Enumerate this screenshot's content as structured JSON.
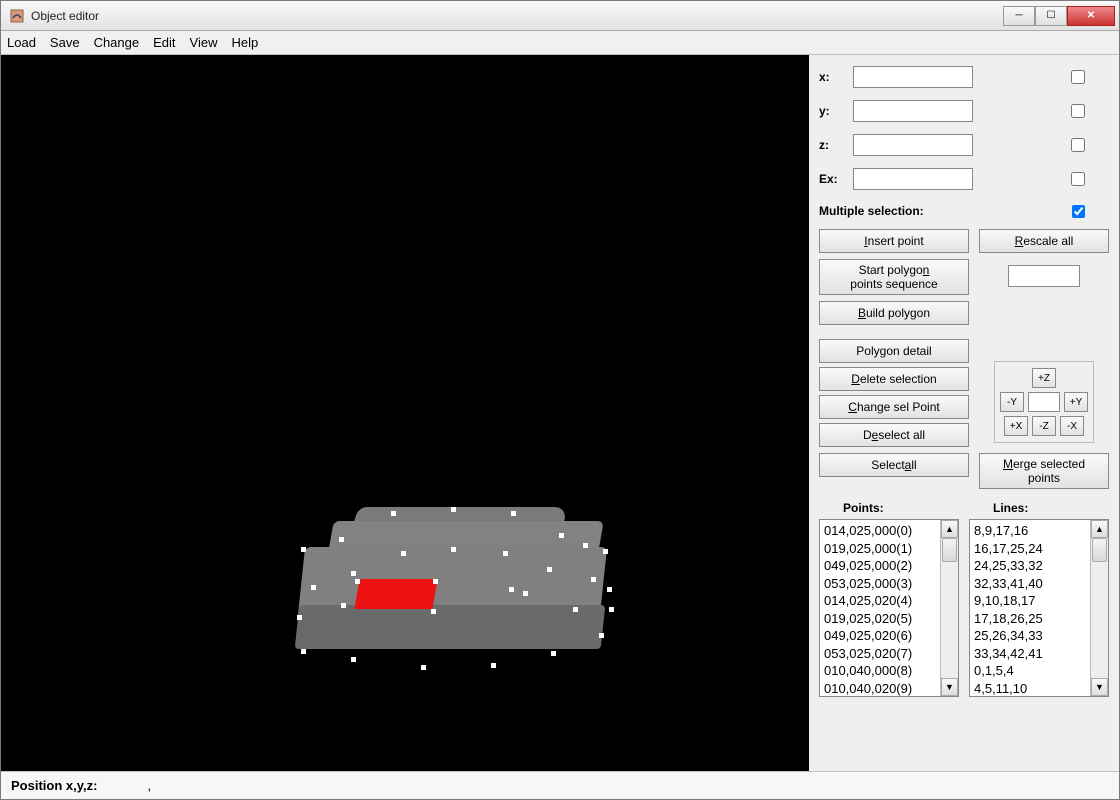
{
  "window": {
    "title": "Object editor"
  },
  "menu": {
    "load": "Load",
    "save": "Save",
    "change": "Change",
    "edit": "Edit",
    "view": "View",
    "help": "Help"
  },
  "coords": {
    "x_label": "x:",
    "x_value": "",
    "y_label": "y:",
    "y_value": "",
    "z_label": "z:",
    "z_value": "",
    "ex_label": "Ex:",
    "ex_value": ""
  },
  "multiple_selection_label": "Multiple selection:",
  "multiple_selection_checked": true,
  "buttons": {
    "insert_point": "Insert point",
    "rescale_all": "Rescale all",
    "start_polygon_l1": "Start polygon",
    "start_polygon_l2": "points sequence",
    "build_polygon": "Build polygon",
    "polygon_detail": "Polygon detail",
    "delete_selection": "Delete selection",
    "change_sel_point": "Change sel Point",
    "deselect_all": "Deselect all",
    "select_all": "Select all",
    "merge_l1": "Merge selected",
    "merge_l2": "points"
  },
  "nav": {
    "plus_z": "+Z",
    "minus_y": "-Y",
    "plus_y": "+Y",
    "plus_x": "+X",
    "minus_z": "-Z",
    "minus_x": "-X",
    "value": ""
  },
  "rescale_value": "",
  "points_header": "Points:",
  "lines_header": "Lines:",
  "points": [
    "014,025,000(0)",
    "019,025,000(1)",
    "049,025,000(2)",
    "053,025,000(3)",
    "014,025,020(4)",
    "019,025,020(5)",
    "049,025,020(6)",
    "053,025,020(7)",
    "010,040,000(8)",
    "010,040,020(9)"
  ],
  "lines": [
    "8,9,17,16",
    "16,17,25,24",
    "24,25,33,32",
    "32,33,41,40",
    "9,10,18,17",
    "17,18,26,25",
    "25,26,34,33",
    "33,34,42,41",
    "0,1,5,4",
    "4,5,11,10"
  ],
  "status": {
    "label": "Position x,y,z:",
    "value": ","
  }
}
